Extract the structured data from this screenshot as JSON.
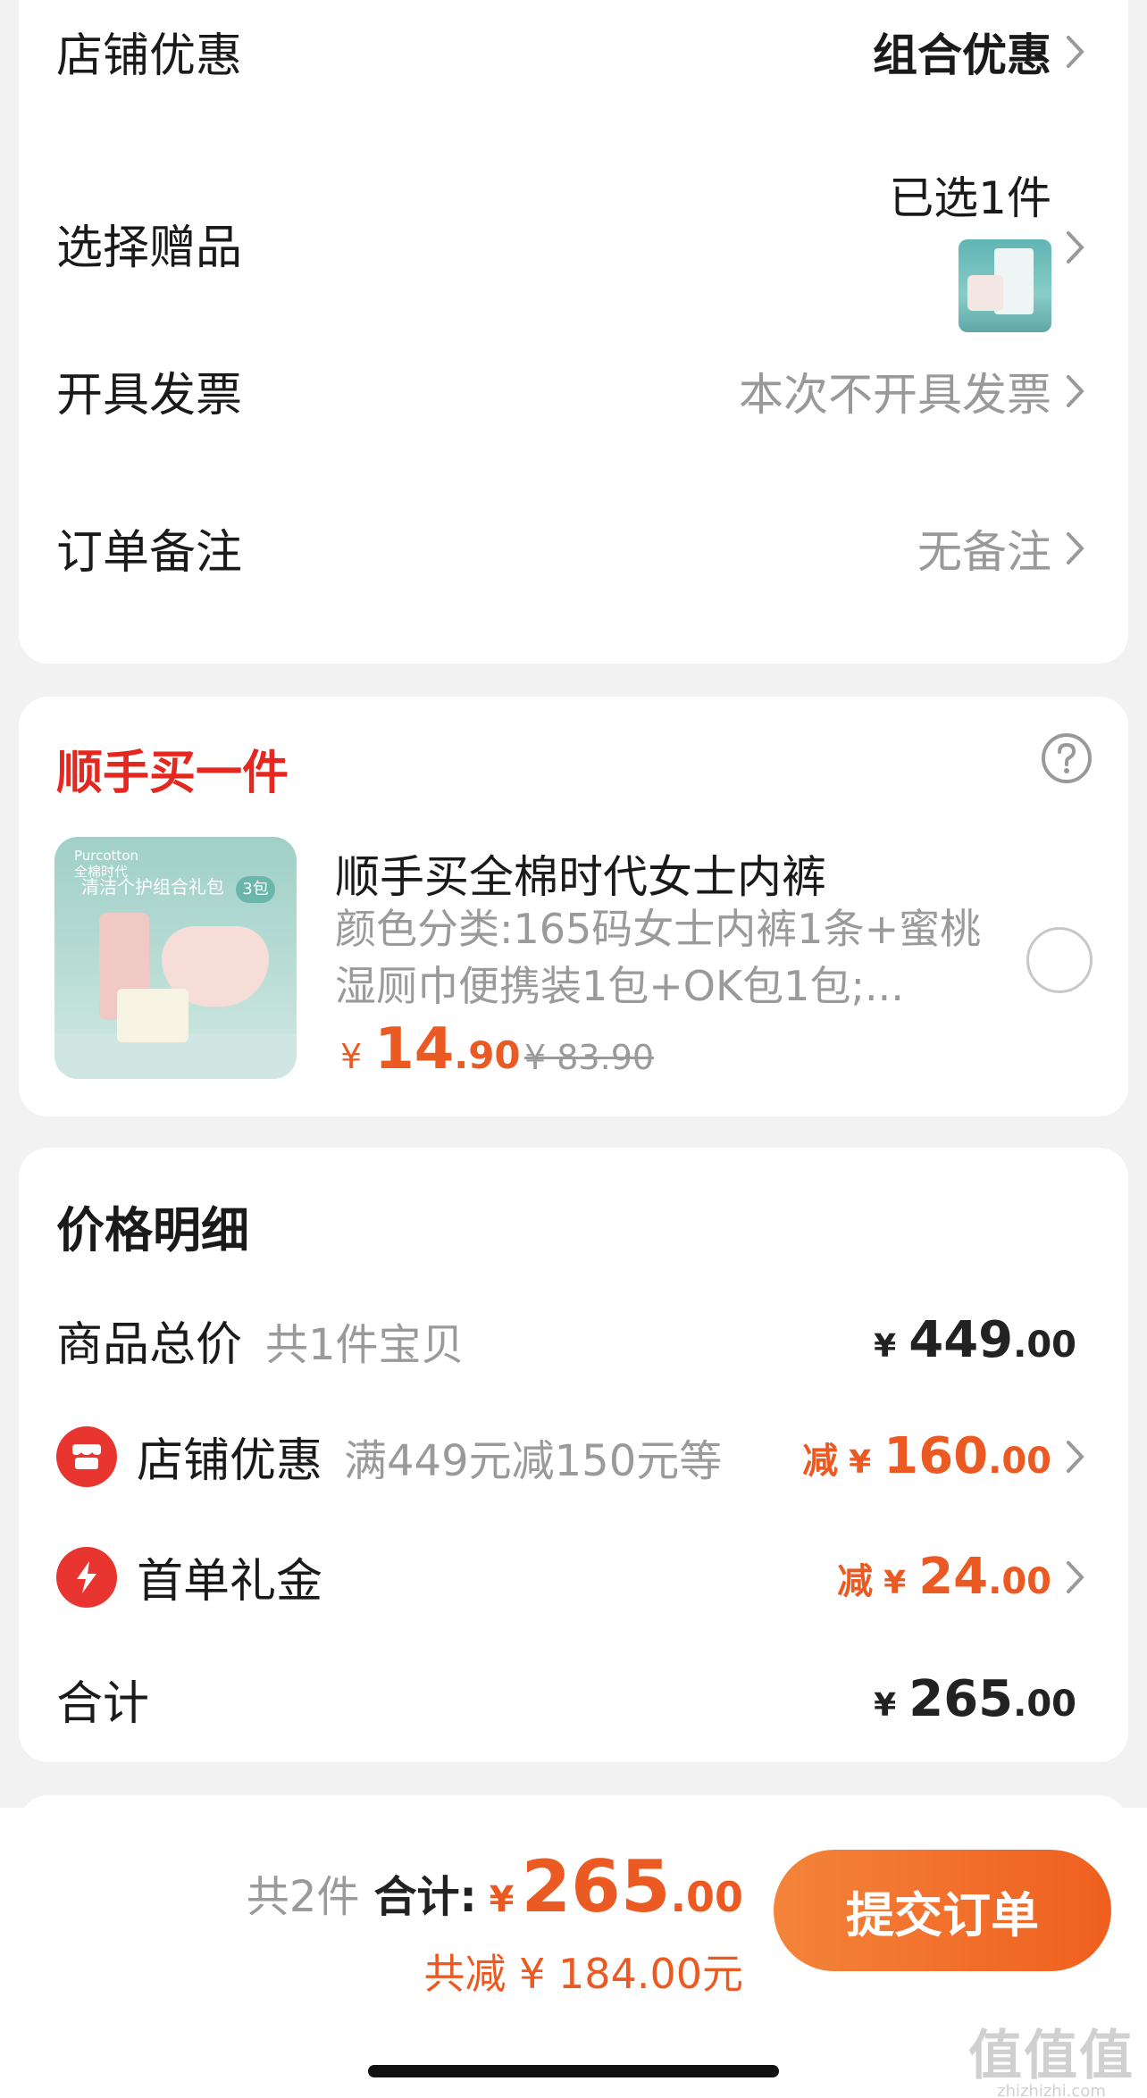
{
  "top_card": {
    "shop_discount": {
      "label": "店铺优惠",
      "value": "组合优惠"
    },
    "gift": {
      "label": "选择赠品",
      "value": "已选1件"
    },
    "invoice": {
      "label": "开具发票",
      "value": "本次不开具发票"
    },
    "note": {
      "label": "订单备注",
      "value": "无备注"
    }
  },
  "addon": {
    "title": "顺手买一件",
    "product": {
      "image_brand": "Purcotton\n全棉时代",
      "image_ribbon": "清洁个护组合礼包",
      "image_badge": "3包",
      "name": "顺手买全棉时代女士内裤",
      "desc": "颜色分类:165码女士内裤1条+蜜桃湿厕巾便携装1包+OK包1包;...",
      "price_symbol": "¥",
      "price_int": "14",
      "price_dec": ".90",
      "orig_price": "¥ 83.90"
    }
  },
  "price_detail": {
    "title": "价格明细",
    "goods_total": {
      "label": "商品总价",
      "sub": "共1件宝贝",
      "yen": "¥",
      "int": "449",
      "dec": ".00"
    },
    "shop_discount": {
      "label": "店铺优惠",
      "sub": "满449元减150元等",
      "prefix": "减",
      "yen": "¥",
      "int": "160",
      "dec": ".00"
    },
    "first_order": {
      "label": "首单礼金",
      "prefix": "减",
      "yen": "¥",
      "int": "24",
      "dec": ".00"
    },
    "total": {
      "label": "合计",
      "yen": "¥",
      "int": "265",
      "dec": ".00"
    }
  },
  "bottom_bar": {
    "count": "共2件",
    "label": "合计:",
    "yen": "¥",
    "int": "265",
    "dec": ".00",
    "saved": "共减 ¥ 184.00元",
    "submit": "提交订单"
  },
  "watermark": {
    "line1": "值值值",
    "line2": "zhizhizhi.com"
  },
  "colors": {
    "accent": "#ea5a22",
    "red": "#e5281f",
    "badge": "#e8352f"
  }
}
